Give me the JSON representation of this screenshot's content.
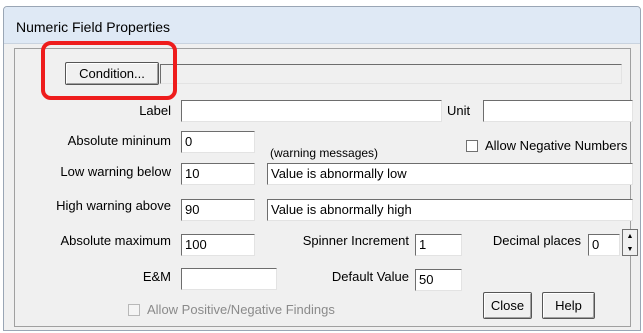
{
  "window": {
    "title": "Numeric Field Properties"
  },
  "buttons": {
    "condition": "Condition...",
    "close": "Close",
    "help": "Help"
  },
  "fields": {
    "label": {
      "label": "Label",
      "value": ""
    },
    "unit": {
      "label": "Unit",
      "value": ""
    },
    "absolute_minimum": {
      "label": "Absolute mininum",
      "value": "0"
    },
    "low_warning": {
      "label": "Low warning below",
      "value": "10",
      "message": "Value is abnormally low"
    },
    "high_warning": {
      "label": "High warning above",
      "value": "90",
      "message": "Value is abnormally high"
    },
    "absolute_maximum": {
      "label": "Absolute maximum",
      "value": "100"
    },
    "spinner_increment": {
      "label": "Spinner Increment",
      "value": "1"
    },
    "decimal_places": {
      "label": "Decimal places",
      "value": "0"
    },
    "em": {
      "label": "E&M",
      "value": ""
    },
    "default_value": {
      "label": "Default Value",
      "value": "50"
    }
  },
  "warning_messages_heading": "(warning messages)",
  "checkboxes": {
    "allow_negative": {
      "label": "Allow Negative Numbers",
      "checked": false
    },
    "allow_findings": {
      "label": "Allow Positive/Negative Findings",
      "checked": false,
      "enabled": false
    }
  },
  "highlight_color": "#ee1c1c"
}
